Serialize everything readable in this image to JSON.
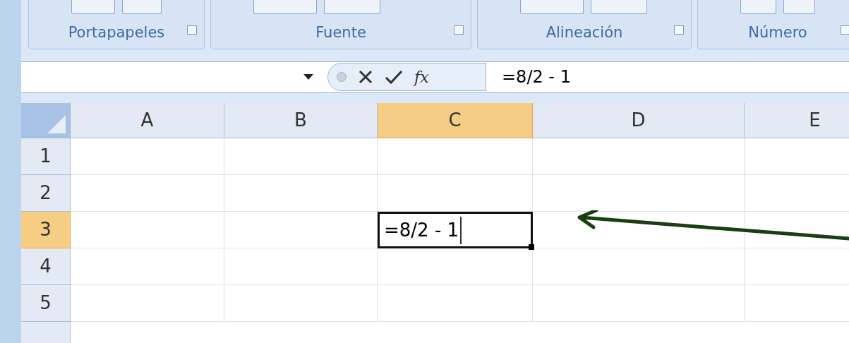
{
  "ribbon_groups": [
    {
      "label": "Portapapeles"
    },
    {
      "label": "Fuente"
    },
    {
      "label": "Alineación"
    },
    {
      "label": "Número"
    }
  ],
  "formula_bar": {
    "function_label": "fx",
    "formula": "=8/2 - 1"
  },
  "columns": [
    {
      "label": "A",
      "selected": false
    },
    {
      "label": "B",
      "selected": false
    },
    {
      "label": "C",
      "selected": true
    },
    {
      "label": "D",
      "selected": false
    },
    {
      "label": "E",
      "selected": false
    }
  ],
  "rows": [
    {
      "label": "1",
      "selected": false
    },
    {
      "label": "2",
      "selected": false
    },
    {
      "label": "3",
      "selected": true
    },
    {
      "label": "4",
      "selected": false
    },
    {
      "label": "5",
      "selected": false
    }
  ],
  "active_cell": {
    "value": "=8/2 - 1"
  }
}
